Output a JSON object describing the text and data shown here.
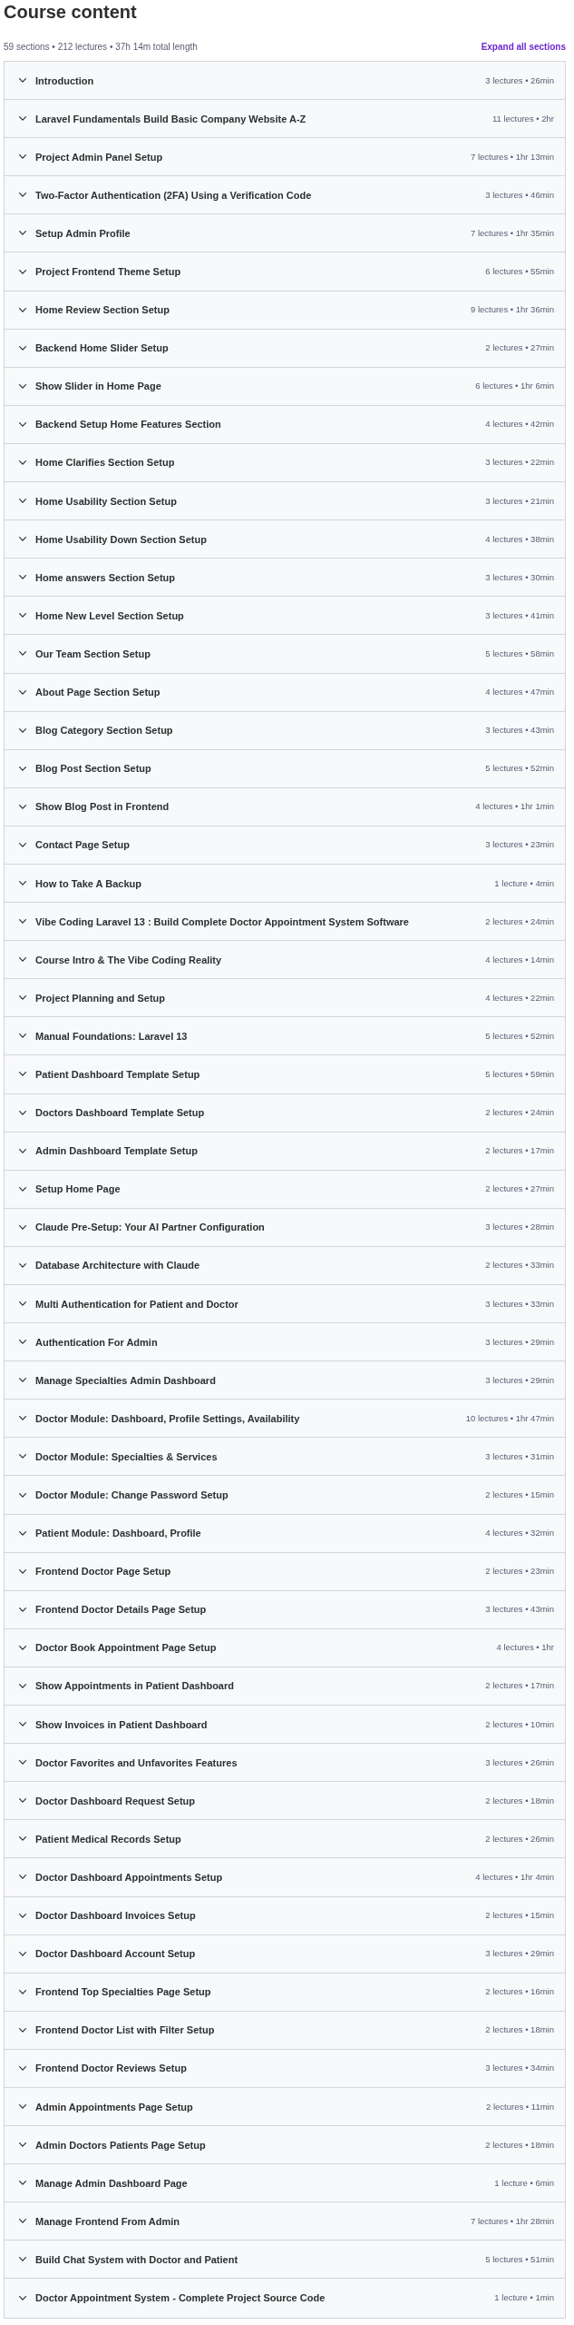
{
  "title": "Course content",
  "summary": "59 sections • 212 lectures • 37h 14m total length",
  "expand_all": "Expand all sections",
  "sections": [
    {
      "title": "Introduction",
      "details": "3 lectures • 26min",
      "expanded": false
    },
    {
      "title": "Laravel Fundamentals Build Basic Company Website A-Z",
      "details": "11 lectures • 2hr",
      "expanded": false
    },
    {
      "title": "Project Admin Panel Setup",
      "details": "7 lectures • 1hr 13min",
      "expanded": false
    },
    {
      "title": "Two-Factor Authentication (2FA) Using a Verification Code",
      "details": "3 lectures • 46min",
      "expanded": false
    },
    {
      "title": "Setup Admin Profile",
      "details": "7 lectures • 1hr 35min",
      "expanded": false
    },
    {
      "title": "Project Frontend Theme Setup",
      "details": "6 lectures • 55min",
      "expanded": false
    },
    {
      "title": "Home Review Section Setup",
      "details": "9 lectures • 1hr 36min",
      "expanded": false
    },
    {
      "title": "Backend Home Slider Setup",
      "details": "2 lectures • 27min",
      "expanded": false
    },
    {
      "title": "Show Slider in Home Page",
      "details": "6 lectures • 1hr 6min",
      "expanded": false
    },
    {
      "title": "Backend Setup Home Features Section",
      "details": "4 lectures • 42min",
      "expanded": false
    },
    {
      "title": "Home Clarifies Section Setup",
      "details": "3 lectures • 22min",
      "expanded": false
    },
    {
      "title": "Home Usability Section Setup",
      "details": "3 lectures • 21min",
      "expanded": false
    },
    {
      "title": "Home Usability Down Section Setup",
      "details": "4 lectures • 38min",
      "expanded": false
    },
    {
      "title": "Home answers Section Setup",
      "details": "3 lectures • 30min",
      "expanded": false
    },
    {
      "title": "Home New Level Section Setup",
      "details": "3 lectures • 41min",
      "expanded": false
    },
    {
      "title": "Our Team Section Setup",
      "details": "5 lectures • 58min",
      "expanded": false
    },
    {
      "title": "About Page Section Setup",
      "details": "4 lectures • 47min",
      "expanded": false
    },
    {
      "title": "Blog Category Section Setup",
      "details": "3 lectures • 43min",
      "expanded": false
    },
    {
      "title": "Blog Post Section Setup",
      "details": "5 lectures • 52min",
      "expanded": false
    },
    {
      "title": "Show Blog Post in Frontend",
      "details": "4 lectures • 1hr 1min",
      "expanded": false
    },
    {
      "title": "Contact Page Setup",
      "details": "3 lectures • 23min",
      "expanded": false
    },
    {
      "title": "How to Take A Backup",
      "details": "1 lecture • 4min",
      "expanded": false
    },
    {
      "title": "Vibe Coding Laravel 13 : Build Complete Doctor Appointment System Software",
      "details": "2 lectures • 24min",
      "expanded": false
    },
    {
      "title": "Course Intro & The Vibe Coding Reality",
      "details": "4 lectures • 14min",
      "expanded": false
    },
    {
      "title": "Project Planning and Setup",
      "details": "4 lectures • 22min",
      "expanded": false
    },
    {
      "title": "Manual Foundations: Laravel 13",
      "details": "5 lectures • 52min",
      "expanded": false
    },
    {
      "title": "Patient Dashboard Template Setup",
      "details": "5 lectures • 59min",
      "expanded": false
    },
    {
      "title": "Doctors Dashboard Template Setup",
      "details": "2 lectures • 24min",
      "expanded": false
    },
    {
      "title": "Admin Dashboard Template Setup",
      "details": "2 lectures • 17min",
      "expanded": false
    },
    {
      "title": "Setup Home Page",
      "details": "2 lectures • 27min",
      "expanded": false
    },
    {
      "title": "Claude Pre-Setup: Your AI Partner Configuration",
      "details": "3 lectures • 28min",
      "expanded": false
    },
    {
      "title": "Database Architecture with Claude",
      "details": "2 lectures • 33min",
      "expanded": false
    },
    {
      "title": "Multi Authentication for Patient and Doctor",
      "details": "3 lectures • 33min",
      "expanded": false
    },
    {
      "title": "Authentication For Admin",
      "details": "3 lectures • 29min",
      "expanded": false
    },
    {
      "title": "Manage Specialties Admin Dashboard",
      "details": "3 lectures • 29min",
      "expanded": false
    },
    {
      "title": "Doctor Module: Dashboard, Profile Settings, Availability",
      "details": "10 lectures • 1hr 47min",
      "expanded": false
    },
    {
      "title": "Doctor Module: Specialties & Services",
      "details": "3 lectures • 31min",
      "expanded": false
    },
    {
      "title": "Doctor Module: Change Password Setup",
      "details": "2 lectures • 15min",
      "expanded": false
    },
    {
      "title": "Patient Module: Dashboard, Profile",
      "details": "4 lectures • 32min",
      "expanded": false
    },
    {
      "title": "Frontend Doctor Page Setup",
      "details": "2 lectures • 23min",
      "expanded": false
    },
    {
      "title": "Frontend Doctor Details Page Setup",
      "details": "3 lectures • 43min",
      "expanded": false
    },
    {
      "title": "Doctor Book Appointment Page Setup",
      "details": "4 lectures • 1hr",
      "expanded": false
    },
    {
      "title": "Show Appointments in Patient Dashboard",
      "details": "2 lectures • 17min",
      "expanded": false
    },
    {
      "title": "Show Invoices in Patient Dashboard",
      "details": "2 lectures • 10min",
      "expanded": false
    },
    {
      "title": "Doctor Favorites and Unfavorites Features",
      "details": "3 lectures • 26min",
      "expanded": false
    },
    {
      "title": "Doctor Dashboard Request Setup",
      "details": "2 lectures • 18min",
      "expanded": false
    },
    {
      "title": "Patient Medical Records Setup",
      "details": "2 lectures • 26min",
      "expanded": false
    },
    {
      "title": "Doctor Dashboard Appointments Setup",
      "details": "4 lectures • 1hr 4min",
      "expanded": false
    },
    {
      "title": "Doctor Dashboard Invoices Setup",
      "details": "2 lectures • 15min",
      "expanded": false
    },
    {
      "title": "Doctor Dashboard Account Setup",
      "details": "3 lectures • 29min",
      "expanded": false
    },
    {
      "title": "Frontend Top Specialties Page Setup",
      "details": "2 lectures • 16min",
      "expanded": false
    },
    {
      "title": "Frontend Doctor List with Filter Setup",
      "details": "2 lectures • 18min",
      "expanded": false
    },
    {
      "title": "Frontend Doctor Reviews Setup",
      "details": "3 lectures • 34min",
      "expanded": false
    },
    {
      "title": "Admin Appointments Page Setup",
      "details": "2 lectures • 11min",
      "expanded": false
    },
    {
      "title": "Admin Doctors Patients Page Setup",
      "details": "2 lectures • 18min",
      "expanded": false
    },
    {
      "title": "Manage Admin Dashboard Page",
      "details": "1 lecture • 6min",
      "expanded": false
    },
    {
      "title": "Manage Frontend From Admin",
      "details": "7 lectures • 1hr 28min",
      "expanded": false
    },
    {
      "title": "Build Chat System with Doctor and Patient",
      "details": "5 lectures • 51min",
      "expanded": false
    },
    {
      "title": "Doctor Appointment System - Complete Project Source Code",
      "details": "1 lecture • 1min",
      "expanded": false
    }
  ]
}
